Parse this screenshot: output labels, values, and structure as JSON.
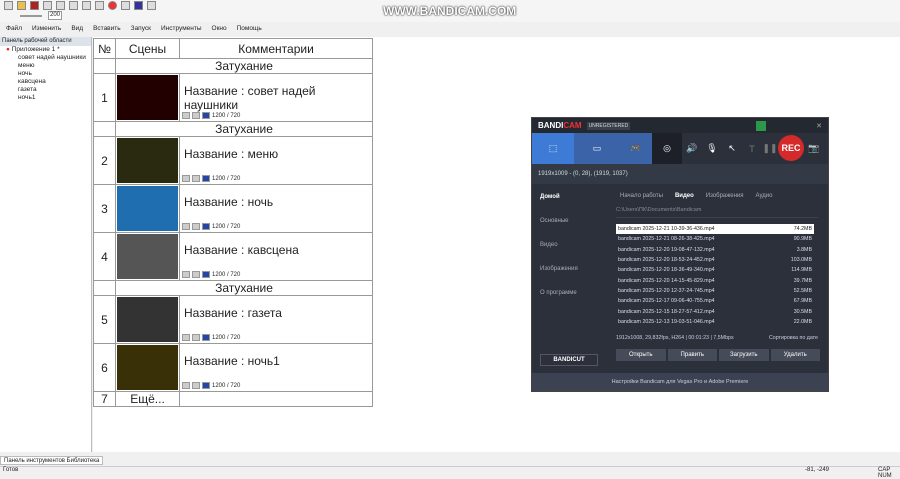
{
  "watermark": "WWW.BANDICAM.COM",
  "toolbar": {
    "zoom_value": "200"
  },
  "menu": [
    "Файл",
    "Изменить",
    "Вид",
    "Вставить",
    "Запуск",
    "Инструменты",
    "Окно",
    "Помощь"
  ],
  "left_panel": {
    "title": "Панель рабочей области",
    "root": "Приложение 1 *",
    "items": [
      "совет надей наушники",
      "меню",
      "ночь",
      "кавсцена",
      "газета",
      "ночь1"
    ]
  },
  "table": {
    "headers": [
      "№",
      "Сцены",
      "Комментарии"
    ],
    "fade_label": "Затухание",
    "resolution": "1200 /  720",
    "rows": [
      {
        "n": "1",
        "name": "Название : совет надей наушники",
        "fade": true,
        "thumb": "#200"
      },
      {
        "n": "2",
        "name": "Название : меню",
        "fade": true,
        "thumb": "#2a2a10"
      },
      {
        "n": "3",
        "name": "Название : ночь",
        "fade": false,
        "thumb": "#1f6fb0"
      },
      {
        "n": "4",
        "name": "Название : кавсцена",
        "fade": false,
        "thumb": "#555"
      },
      {
        "n": "5",
        "name": "Название : газета",
        "fade": true,
        "thumb": "#333"
      },
      {
        "n": "6",
        "name": "Название : ночь1",
        "fade": false,
        "thumb": "#3a3008"
      }
    ],
    "more_n": "7",
    "more_label": "Ещё..."
  },
  "bottom_tabs": "Панель инструментов  Библиотека",
  "status": {
    "left": "Готов",
    "coords": "-81, -249",
    "right": "CAP NUM"
  },
  "bandicam": {
    "logo_a": "BANDI",
    "logo_b": "CAM",
    "unregistered": "UNREGISTERED",
    "rec": "REC",
    "area": "1919x1009 - (0, 28), (1919, 1037)",
    "side": [
      "Домой",
      "Основные",
      "Видео",
      "Изображения",
      "О программе"
    ],
    "tabs": [
      "Начало работы",
      "Видео",
      "Изображения",
      "Аудио"
    ],
    "path": "C:\\Users\\ПК\\Documents\\Bandicam",
    "files": [
      [
        "bandicam 2025-12-21 10-39-36-436.mp4",
        "74.2MB"
      ],
      [
        "bandicam 2025-12-21 08-26-38-425.mp4",
        "90.9MB"
      ],
      [
        "bandicam 2025-12-20 19-08-47-132.mp4",
        "3.8MB"
      ],
      [
        "bandicam 2025-12-20 18-53-24-452.mp4",
        "103.0MB"
      ],
      [
        "bandicam 2025-12-20 18-36-49-340.mp4",
        "114.9MB"
      ],
      [
        "bandicam 2025-12-20 14-15-45-829.mp4",
        "39.7MB"
      ],
      [
        "bandicam 2025-12-20 12-37-24-745.mp4",
        "52.5MB"
      ],
      [
        "bandicam 2025-12-17 09-06-40-755.mp4",
        "67.9MB"
      ],
      [
        "bandicam 2025-12-15 18-27-57-412.mp4",
        "30.5MB"
      ],
      [
        "bandicam 2025-12-13 19-03-51-046.mp4",
        "22.0MB"
      ]
    ],
    "meta": "1912x1008, 29,832fps, H264 | 00:01:23 | 7,5Mbps",
    "sort": "Сортировка по дате",
    "buttons": [
      "Открыть",
      "Править",
      "Загрузить",
      "Удалить"
    ],
    "bandicut": "BANDICUT",
    "footer": "Настройки Bandicam для Vegas Pro и Adobe Premiere"
  }
}
